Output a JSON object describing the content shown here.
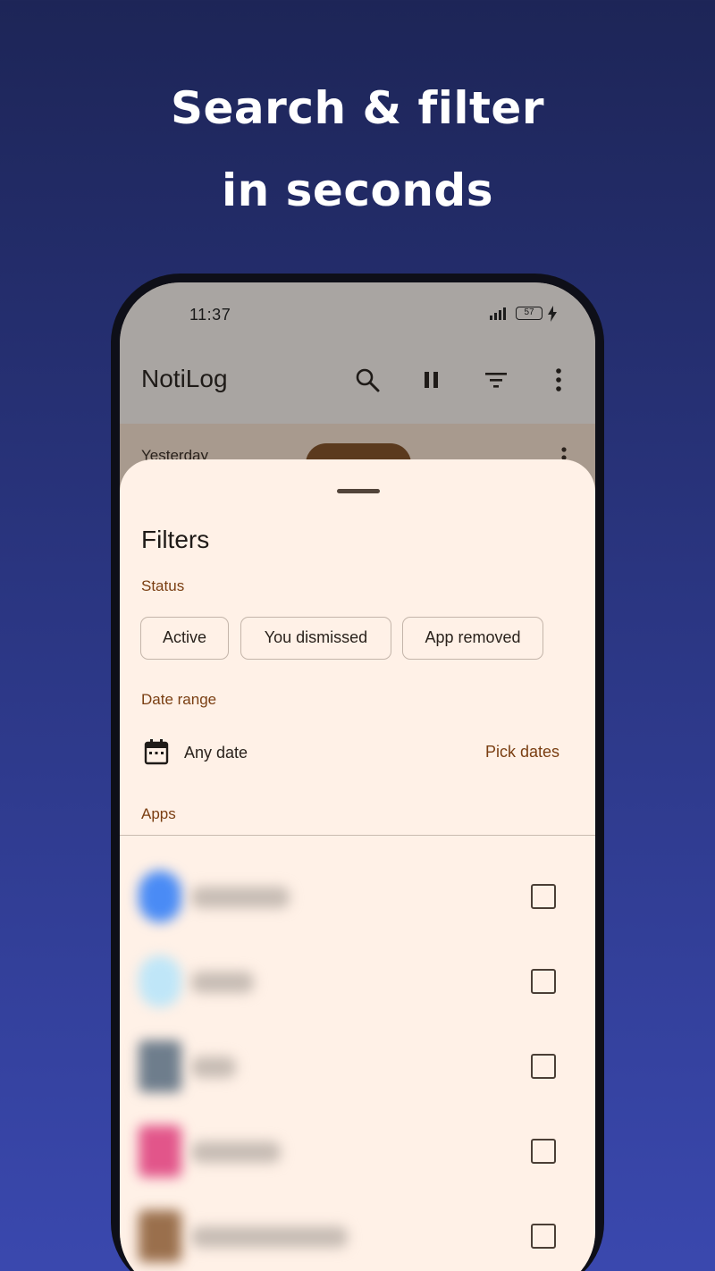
{
  "headline": {
    "line1": "Search & filter",
    "line2": "in seconds"
  },
  "status_bar": {
    "time": "11:37",
    "battery": "57"
  },
  "appbar": {
    "title": "NotiLog",
    "icons": [
      "search-icon",
      "pause-icon",
      "filter-icon",
      "more-vert-icon"
    ]
  },
  "behind_list": {
    "section": "Yesterday"
  },
  "filters": {
    "title": "Filters",
    "status_label": "Status",
    "status_chips": [
      "Active",
      "You dismissed",
      "App removed"
    ],
    "date_range_label": "Date range",
    "date_value": "Any date",
    "pick_dates": "Pick dates",
    "apps_label": "Apps"
  },
  "apps": [
    {
      "icon_color": "#4a8bf5",
      "checked": false
    },
    {
      "icon_color": "#bfe6f8",
      "checked": false
    },
    {
      "icon_color": "#6e7d8c",
      "checked": false
    },
    {
      "icon_color": "#e2558a",
      "checked": false
    },
    {
      "icon_color": "#9a6f4c",
      "checked": false
    }
  ],
  "colors": {
    "accent": "#7a3e12",
    "sheet_background": "#fff1e7",
    "background_top": "#1d2557",
    "background_bottom": "#3a48ae"
  }
}
